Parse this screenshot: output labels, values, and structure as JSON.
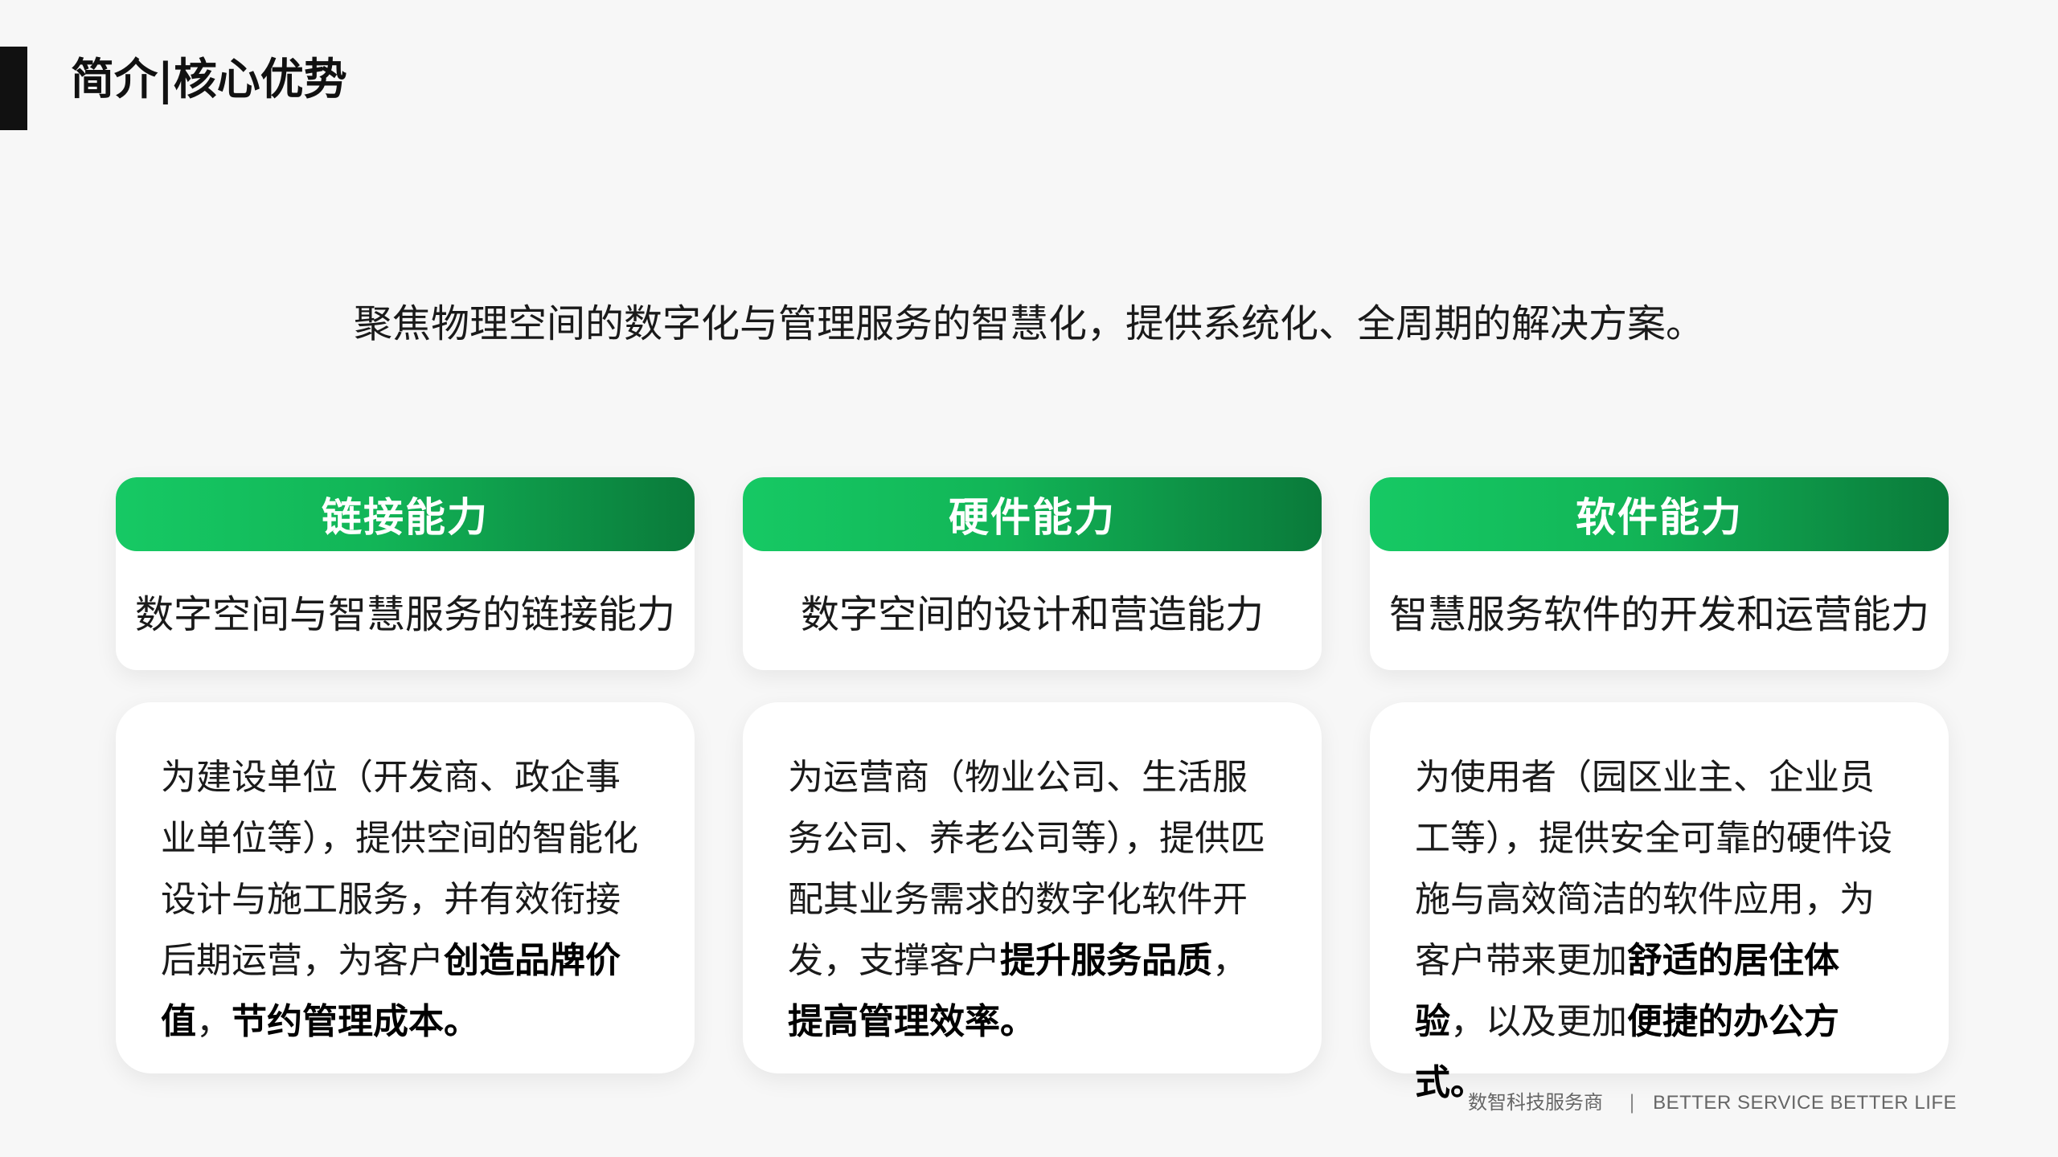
{
  "header": {
    "title": "简介|核心优势"
  },
  "subtitle": "聚焦物理空间的数字化与管理服务的智慧化，提供系统化、全周期的解决方案。",
  "columns": [
    {
      "title": "链接能力",
      "desc": "数字空间与智慧服务的链接能力",
      "detail": {
        "text": "为建设单位（开发商、政企事业单位等），提供空间的智能化设计与施工服务，并有效衔接后期运营，为客户",
        "bold1": "创造品牌价值",
        "mid": "，",
        "bold2": "节约管理成本",
        "end": "。"
      }
    },
    {
      "title": "硬件能力",
      "desc": "数字空间的设计和营造能力",
      "detail": {
        "text": "为运营商（物业公司、生活服务公司、养老公司等），提供匹配其业务需求的数字化软件开发，支撑客户",
        "bold1": "提升服务品质",
        "mid": "，",
        "bold2": "提高管理效率",
        "end": "。"
      }
    },
    {
      "title": "软件能力",
      "desc": "智慧服务软件的开发和运营能力",
      "detail": {
        "text": "为使用者（园区业主、企业员工等），提供安全可靠的硬件设施与高效简洁的软件应用，为客户带来更加",
        "bold1": "舒适的居住体验",
        "mid": "，以及更加",
        "bold2": "便捷的办公方式",
        "end": "。"
      }
    }
  ],
  "footer": {
    "company": "数智科技服务商",
    "separator": "|",
    "slogan": "BETTER SERVICE BETTER LIFE"
  },
  "colors": {
    "accent_start": "#16c964",
    "accent_end": "#0a7a3a",
    "background": "#f7f7f7",
    "card": "#ffffff"
  }
}
